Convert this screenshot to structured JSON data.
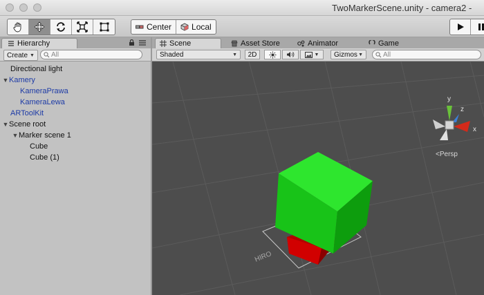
{
  "window": {
    "title": "TwoMarkerScene.unity - camera2 -"
  },
  "toolbar": {
    "tools": [
      {
        "name": "hand-tool-button",
        "icon": "hand-icon"
      },
      {
        "name": "move-tool-button",
        "icon": "move-arrows-icon"
      },
      {
        "name": "rotate-tool-button",
        "icon": "rotate-icon"
      },
      {
        "name": "scale-tool-button",
        "icon": "scale-icon"
      },
      {
        "name": "rect-tool-button",
        "icon": "rect-icon"
      }
    ],
    "pivot_label": "Center",
    "space_label": "Local"
  },
  "hierarchy": {
    "tab_label": "Hierarchy",
    "create_label": "Create",
    "search_placeholder": "All",
    "items": [
      {
        "label": "Directional light"
      },
      {
        "label": "Kamery"
      },
      {
        "label": "KameraPrawa"
      },
      {
        "label": "KameraLewa"
      },
      {
        "label": "ARToolKit"
      },
      {
        "label": "Scene root"
      },
      {
        "label": "Marker scene 1"
      },
      {
        "label": "Cube"
      },
      {
        "label": "Cube (1)"
      }
    ]
  },
  "scene_panel": {
    "tabs": [
      {
        "label": "Scene",
        "icon": "grid-icon"
      },
      {
        "label": "Asset Store",
        "icon": "store-icon"
      },
      {
        "label": "Animator",
        "icon": "animator-icon"
      },
      {
        "label": "Game",
        "icon": "game-icon"
      }
    ],
    "shading_mode": "Shaded",
    "mode_2d_label": "2D",
    "gizmos_label": "Gizmos",
    "search_placeholder": "All",
    "persp_label": "Persp",
    "gizmo_axes": {
      "x": "x",
      "y": "y",
      "z": "z"
    },
    "marker_text": "HIRO"
  },
  "colors": {
    "cube_green": "#1fd31f",
    "cube_red": "#d10000",
    "viewport_bg": "#4d4d4d",
    "hierarchy_link": "#1c3aa6"
  }
}
